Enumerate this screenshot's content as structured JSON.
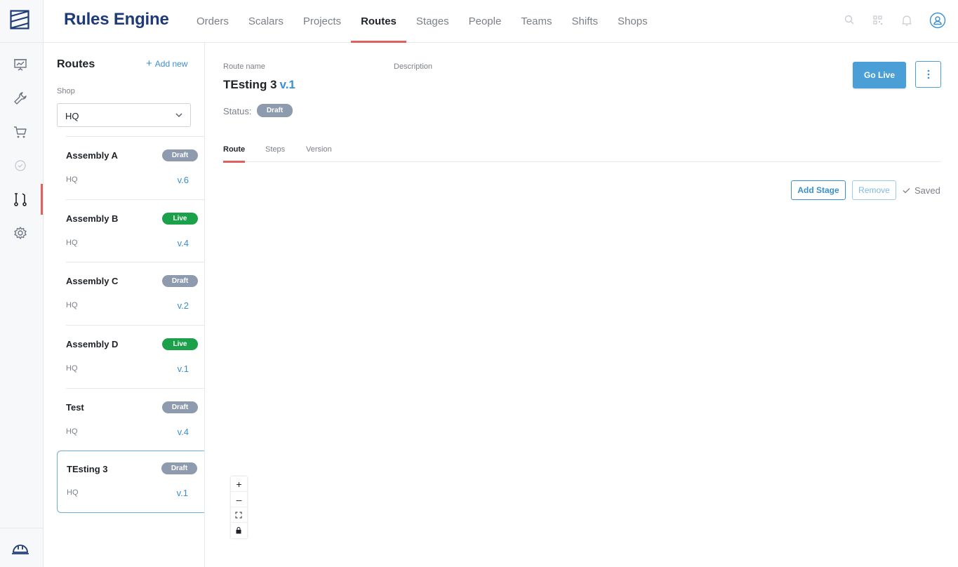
{
  "header": {
    "brand": "Rules Engine",
    "nav": [
      {
        "label": "Orders",
        "active": false
      },
      {
        "label": "Scalars",
        "active": false
      },
      {
        "label": "Projects",
        "active": false
      },
      {
        "label": "Routes",
        "active": true
      },
      {
        "label": "Stages",
        "active": false
      },
      {
        "label": "People",
        "active": false
      },
      {
        "label": "Teams",
        "active": false
      },
      {
        "label": "Shifts",
        "active": false
      },
      {
        "label": "Shops",
        "active": false
      }
    ],
    "icons": [
      "search-icon",
      "qr-code-icon",
      "bell-icon",
      "user-avatar-icon"
    ]
  },
  "rail": {
    "icons": [
      "logo-icon",
      "presentation-chart-icon",
      "wrench-icon",
      "cart-icon",
      "check-circle-icon",
      "routes-icon",
      "gear-icon",
      "hard-hat-icon"
    ],
    "active": "routes-icon"
  },
  "list": {
    "title": "Routes",
    "add_label": "Add new",
    "shop_label": "Shop",
    "shop_value": "HQ",
    "items": [
      {
        "name": "Assembly A",
        "status": "Draft",
        "shop": "HQ",
        "version": "v.6"
      },
      {
        "name": "Assembly B",
        "status": "Live",
        "shop": "HQ",
        "version": "v.4"
      },
      {
        "name": "Assembly C",
        "status": "Draft",
        "shop": "HQ",
        "version": "v.2"
      },
      {
        "name": "Assembly D",
        "status": "Live",
        "shop": "HQ",
        "version": "v.1"
      },
      {
        "name": "Test",
        "status": "Draft",
        "shop": "HQ",
        "version": "v.4"
      },
      {
        "name": "TEsting 3",
        "status": "Draft",
        "shop": "HQ",
        "version": "v.1",
        "selected": true
      }
    ]
  },
  "detail": {
    "route_name_label": "Route name",
    "description_label": "Description",
    "route_name": "TEsting 3",
    "version": "v.1",
    "status_label": "Status:",
    "status": "Draft",
    "go_live_label": "Go Live",
    "tabs": [
      {
        "label": "Route",
        "active": true
      },
      {
        "label": "Steps",
        "active": false
      },
      {
        "label": "Version",
        "active": false
      }
    ],
    "add_stage_label": "Add Stage",
    "remove_label": "Remove",
    "saved_label": "Saved"
  },
  "zoom": {
    "zoom_in": "+",
    "zoom_out": "–"
  },
  "colors": {
    "brand": "#1e3a78",
    "accent": "#3a8fd0",
    "active_underline": "#e05f5f",
    "draft_badge": "#8e9aae",
    "live_badge": "#1aa14a"
  }
}
